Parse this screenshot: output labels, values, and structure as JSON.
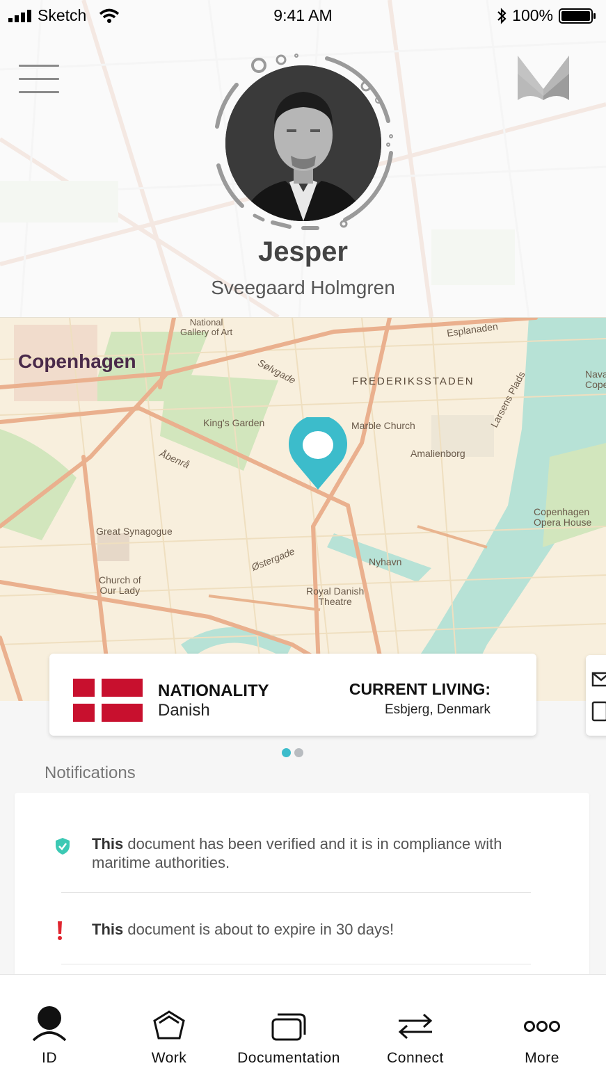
{
  "status_bar": {
    "carrier": "Sketch",
    "time": "9:41 AM",
    "battery": "100%"
  },
  "header": {
    "menu_icon": "hamburger-icon",
    "logo_icon": "m-logo-icon"
  },
  "profile": {
    "first_name": "Jesper",
    "last_name": "Sveegaard Holmgren"
  },
  "map": {
    "labels": {
      "city": "Copenhagen",
      "national_gallery": "National\nGallery of Art",
      "esplanaden": "Esplanaden",
      "solvgade": "Sølvgade",
      "frederiksstaden": "FREDERIKSSTADEN",
      "kings_garden": "King's Garden",
      "marble_church": "Marble Church",
      "amalienborg": "Amalienborg",
      "larsens_plads": "Larsens Plads",
      "abenra": "Åbenrå",
      "great_synagogue": "Great Synagogue",
      "church_of_our_lady": "Church of\nOur Lady",
      "ostergade": "Østergade",
      "royal_danish_theatre": "Royal Danish\nTheatre",
      "nyhavn": "Nyhavn",
      "opera_house": "Copenhagen\nOpera House",
      "navy_partial": "Nava\nCope"
    },
    "pin_color": "#3cbccb"
  },
  "info_card": {
    "nationality_title": "NATIONALITY",
    "nationality_value": "Danish",
    "current_living_title": "CURRENT LIVING:",
    "current_living_value": "Esbjerg, Denmark",
    "flag": "denmark-flag"
  },
  "pager": {
    "count": 2,
    "active": 0
  },
  "notifications": {
    "heading": "Notifications",
    "items": [
      {
        "icon": "verified-shield-icon",
        "bold": "This",
        "text": " document has been verified and it is in compliance with maritime authorities.",
        "color": "#3cc9b4"
      },
      {
        "icon": "alert-icon",
        "bold": "This",
        "text": " document is about to expire in 30 days!",
        "color": "#e0242e"
      }
    ]
  },
  "bottom_nav": {
    "items": [
      {
        "label": "ID",
        "icon": "person-icon"
      },
      {
        "label": "Work",
        "icon": "pentagon-icon"
      },
      {
        "label": "Documentation",
        "icon": "cards-icon"
      },
      {
        "label": "Connect",
        "icon": "swap-arrows-icon"
      },
      {
        "label": "More",
        "icon": "more-circles-icon"
      }
    ]
  },
  "colors": {
    "accent": "#3cbccb",
    "flag_red": "#c8102e",
    "verified": "#3cc9b4",
    "alert": "#e0242e"
  }
}
